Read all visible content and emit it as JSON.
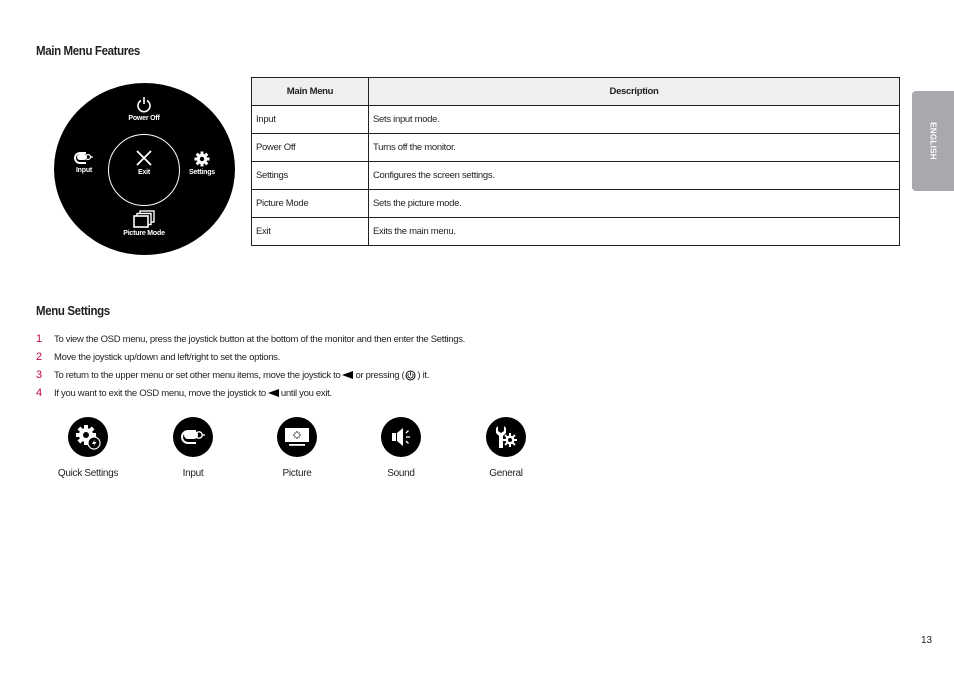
{
  "sections": {
    "features_title": "Main Menu Features",
    "settings_title": "Menu Settings"
  },
  "joystick_menu": {
    "top": {
      "label": "Power Off",
      "icon": "power-icon"
    },
    "left": {
      "label": "Input",
      "icon": "input-icon"
    },
    "center": {
      "label": "Exit",
      "icon": "close-icon"
    },
    "right": {
      "label": "Settings",
      "icon": "gear-icon"
    },
    "bottom": {
      "label": "Picture Mode",
      "icon": "picture-mode-icon"
    }
  },
  "table": {
    "headers": [
      "Main Menu",
      "Description"
    ],
    "rows": [
      [
        "Input",
        "Sets input mode."
      ],
      [
        "Power Off",
        "Turns off the monitor."
      ],
      [
        "Settings",
        "Configures the screen settings."
      ],
      [
        "Picture Mode",
        "Sets the picture mode."
      ],
      [
        "Exit",
        "Exits the main menu."
      ]
    ]
  },
  "language_tab": "ENGLISH",
  "steps": [
    {
      "num": "1",
      "text": "To view the OSD menu, press the joystick button at the bottom of the monitor and then enter the Settings."
    },
    {
      "num": "2",
      "text": "Move the joystick up/down and left/right to set the options."
    },
    {
      "num": "3",
      "text_a": "To return to the upper menu or set other menu items, move the joystick to",
      "text_b": "or pressing (",
      "text_c": ") it."
    },
    {
      "num": "4",
      "text_a": "If you want to exit the OSD menu, move the joystick to",
      "text_b": "until you exit."
    }
  ],
  "menu_icons": [
    {
      "label": "Quick Settings",
      "icon": "quick-settings-icon"
    },
    {
      "label": "Input",
      "icon": "input-icon"
    },
    {
      "label": "Picture",
      "icon": "picture-icon"
    },
    {
      "label": "Sound",
      "icon": "sound-icon"
    },
    {
      "label": "General",
      "icon": "general-icon"
    }
  ],
  "page_number": "13",
  "colors": {
    "accent": "#c4004b",
    "tab": "#a7a9ac",
    "header_bg": "#efefef"
  }
}
